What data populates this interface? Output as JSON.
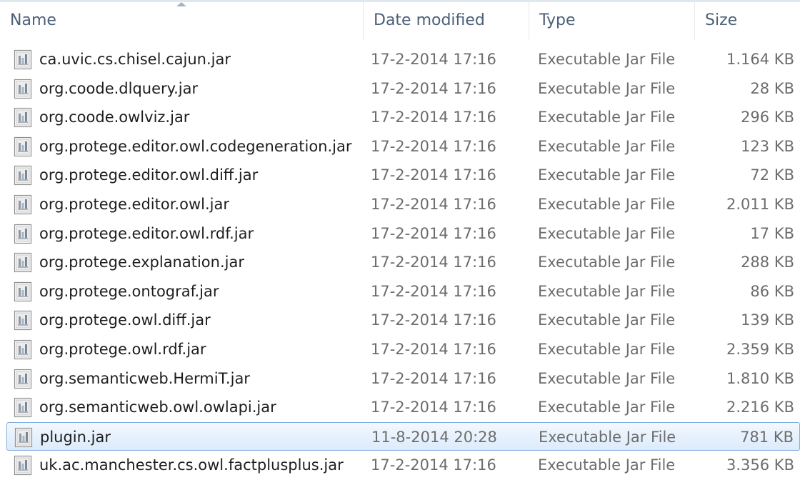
{
  "columns": {
    "name": "Name",
    "date": "Date modified",
    "type": "Type",
    "size": "Size"
  },
  "files": [
    {
      "name": "ca.uvic.cs.chisel.cajun.jar",
      "date": "17-2-2014 17:16",
      "type": "Executable Jar File",
      "size": "1.164 KB",
      "icon": "jar-file-icon"
    },
    {
      "name": "org.coode.dlquery.jar",
      "date": "17-2-2014 17:16",
      "type": "Executable Jar File",
      "size": "28 KB",
      "icon": "jar-file-icon"
    },
    {
      "name": "org.coode.owlviz.jar",
      "date": "17-2-2014 17:16",
      "type": "Executable Jar File",
      "size": "296 KB",
      "icon": "jar-file-icon"
    },
    {
      "name": "org.protege.editor.owl.codegeneration.jar",
      "date": "17-2-2014 17:16",
      "type": "Executable Jar File",
      "size": "123 KB",
      "icon": "jar-file-icon"
    },
    {
      "name": "org.protege.editor.owl.diff.jar",
      "date": "17-2-2014 17:16",
      "type": "Executable Jar File",
      "size": "72 KB",
      "icon": "jar-file-icon"
    },
    {
      "name": "org.protege.editor.owl.jar",
      "date": "17-2-2014 17:16",
      "type": "Executable Jar File",
      "size": "2.011 KB",
      "icon": "jar-file-icon"
    },
    {
      "name": "org.protege.editor.owl.rdf.jar",
      "date": "17-2-2014 17:16",
      "type": "Executable Jar File",
      "size": "17 KB",
      "icon": "jar-file-icon"
    },
    {
      "name": "org.protege.explanation.jar",
      "date": "17-2-2014 17:16",
      "type": "Executable Jar File",
      "size": "288 KB",
      "icon": "jar-file-icon"
    },
    {
      "name": "org.protege.ontograf.jar",
      "date": "17-2-2014 17:16",
      "type": "Executable Jar File",
      "size": "86 KB",
      "icon": "jar-file-icon"
    },
    {
      "name": "org.protege.owl.diff.jar",
      "date": "17-2-2014 17:16",
      "type": "Executable Jar File",
      "size": "139 KB",
      "icon": "jar-file-icon"
    },
    {
      "name": "org.protege.owl.rdf.jar",
      "date": "17-2-2014 17:16",
      "type": "Executable Jar File",
      "size": "2.359 KB",
      "icon": "jar-file-icon"
    },
    {
      "name": "org.semanticweb.HermiT.jar",
      "date": "17-2-2014 17:16",
      "type": "Executable Jar File",
      "size": "1.810 KB",
      "icon": "jar-file-icon"
    },
    {
      "name": "org.semanticweb.owl.owlapi.jar",
      "date": "17-2-2014 17:16",
      "type": "Executable Jar File",
      "size": "2.216 KB",
      "icon": "jar-file-icon"
    },
    {
      "name": "plugin.jar",
      "date": "11-8-2014 20:28",
      "type": "Executable Jar File",
      "size": "781 KB",
      "icon": "jar-file-icon",
      "selected": true
    },
    {
      "name": "uk.ac.manchester.cs.owl.factplusplus.jar",
      "date": "17-2-2014 17:16",
      "type": "Executable Jar File",
      "size": "3.356 KB",
      "icon": "jar-file-icon"
    }
  ],
  "colors": {
    "header_text": "#4c607a",
    "selection_border": "#84acdd",
    "secondary_text": "#6d6d6d"
  }
}
